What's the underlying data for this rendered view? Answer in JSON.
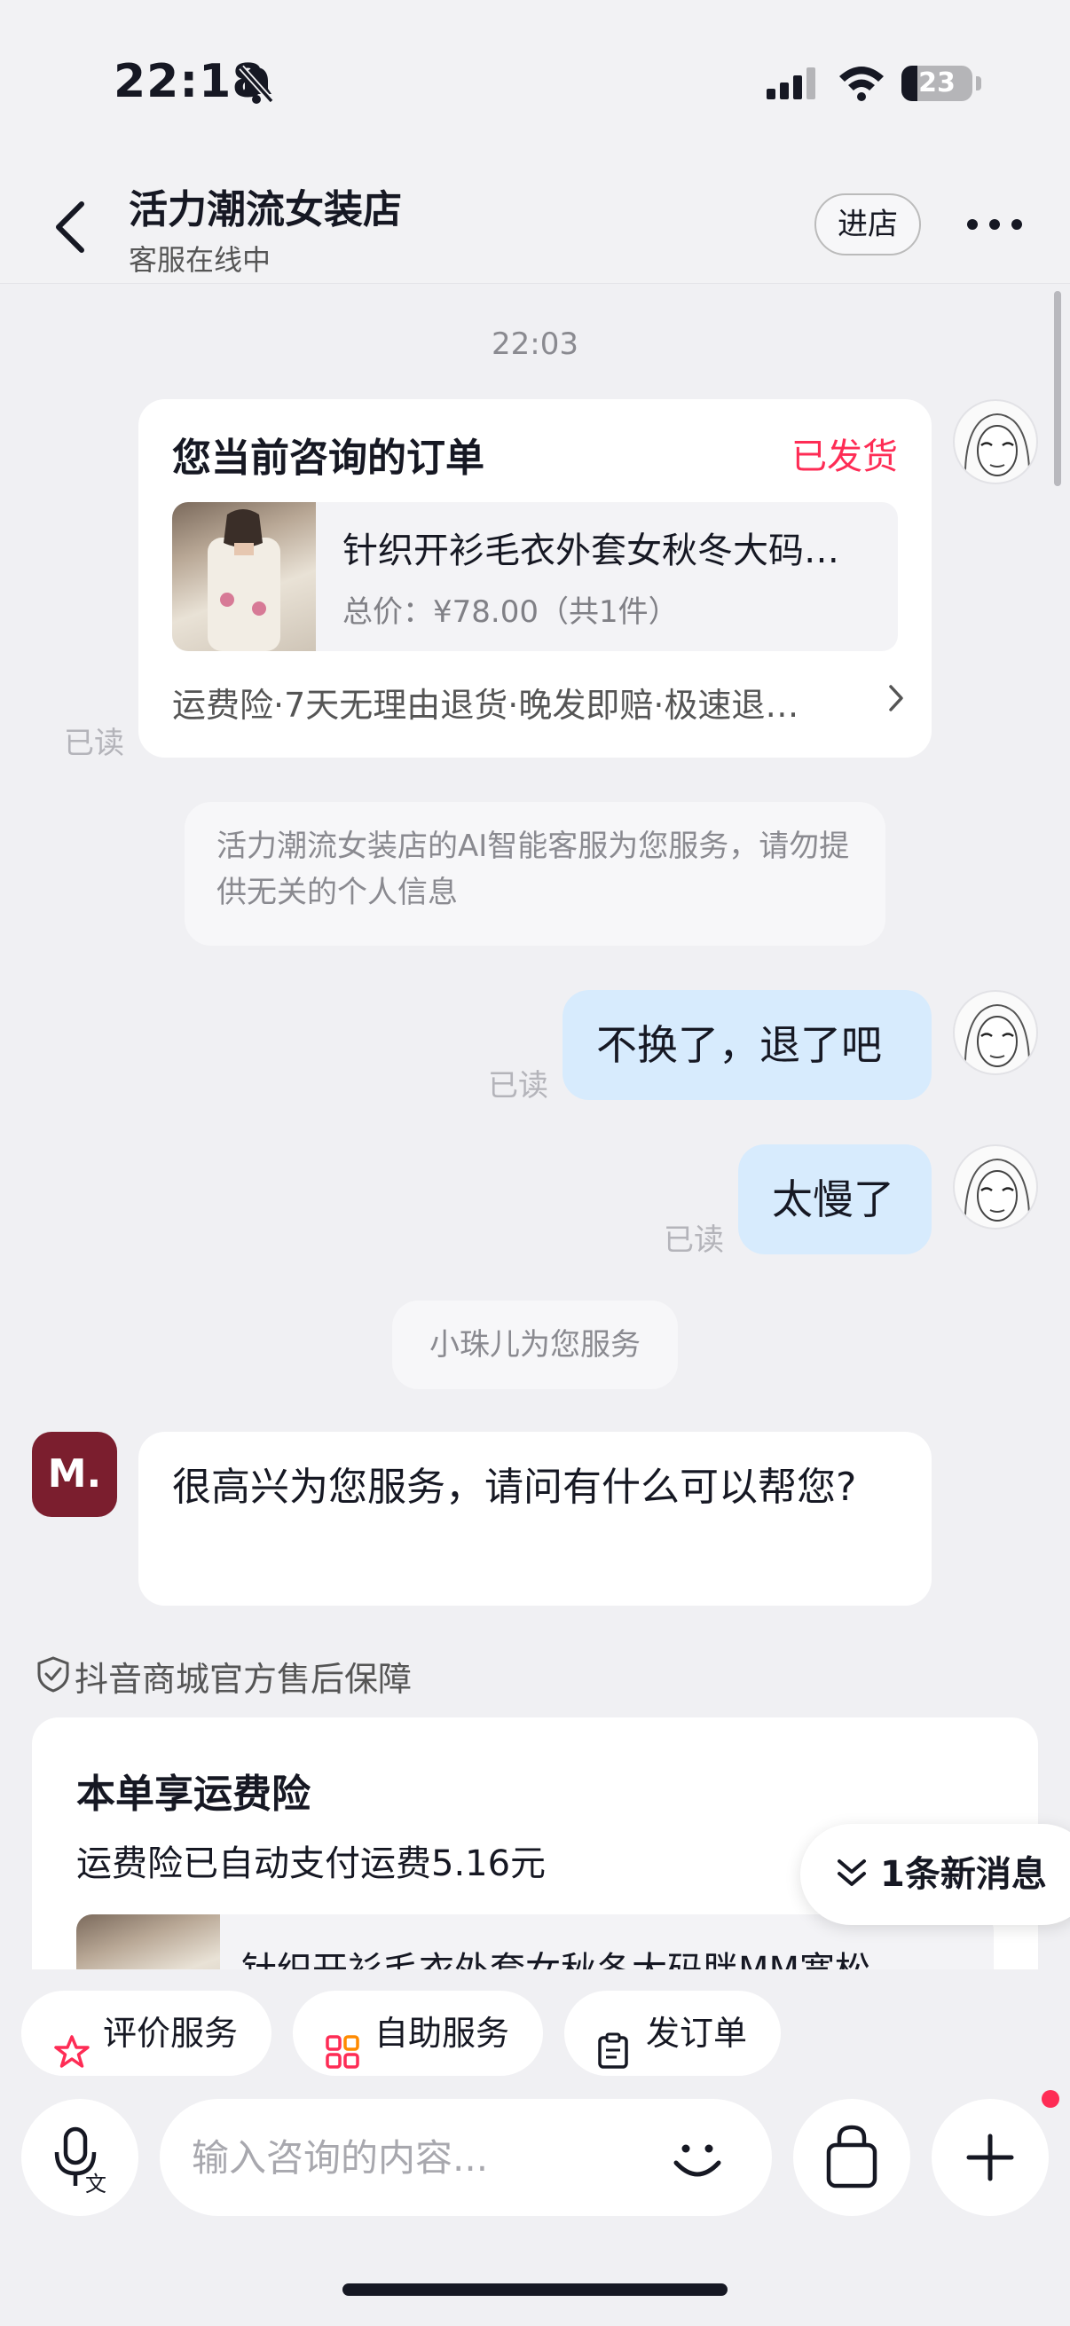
{
  "status_bar": {
    "time": "22:18",
    "battery": "23",
    "battery_level_percent": 23
  },
  "header": {
    "shop_name": "活力潮流女装店",
    "subtitle": "客服在线中",
    "enter_store_label": "进店"
  },
  "chat": {
    "timestamp": "22:03",
    "order_card": {
      "title": "您当前咨询的订单",
      "status": "已发货",
      "product_name": "针织开衫毛衣外套女秋冬大码…",
      "price_text": "总价：¥78.00（共1件）",
      "services": "运费险·7天无理由退货·晚发即赔·极速退…",
      "read_label": "已读"
    },
    "system_notice": "活力潮流女装店的AI智能客服为您服务，请勿提供无关的个人信息",
    "messages_me": [
      {
        "text": "不换了，退了吧",
        "read_label": "已读"
      },
      {
        "text": "太慢了",
        "read_label": "已读"
      }
    ],
    "service_tag": "小珠儿为您服务",
    "agent": {
      "avatar_text": "M.",
      "message": "很高兴为您服务，请问有什么可以帮您?"
    },
    "guarantee": "抖音商城官方售后保障",
    "freight_card": {
      "title": "本单享运费险",
      "desc": "运费险已自动支付运费5.16元",
      "product_name": "针织开衫毛衣外套女秋冬大码胖MM宽松"
    },
    "new_messages_label": "1条新消息"
  },
  "quick_actions": [
    {
      "label": "评价服务",
      "icon": "star-icon"
    },
    {
      "label": "自助服务",
      "icon": "grid-icon"
    },
    {
      "label": "发订单",
      "icon": "clipboard-icon"
    }
  ],
  "input": {
    "placeholder": "输入咨询的内容..."
  },
  "colors": {
    "accent_red": "#fe2c55",
    "my_bubble": "#d7ebfd",
    "agent_avatar": "#7b1e2e"
  }
}
